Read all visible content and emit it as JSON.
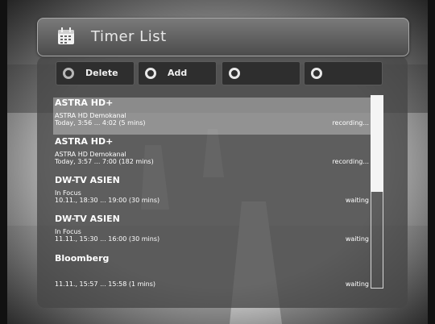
{
  "header": {
    "title": "Timer List",
    "icon": "calendar-icon"
  },
  "buttons": [
    {
      "label": "Delete",
      "color": "grey"
    },
    {
      "label": "Add",
      "color": "white"
    },
    {
      "label": "",
      "color": "white"
    },
    {
      "label": "",
      "color": "white"
    }
  ],
  "timers": [
    {
      "channel": "ASTRA HD+",
      "event": "ASTRA HD Demokanal",
      "time": "Today, 3:56 ... 4:02 (5 mins)",
      "status": "recording..."
    },
    {
      "channel": "ASTRA HD+",
      "event": "ASTRA HD Demokanal",
      "time": "Today, 3:57 ... 7:00 (182 mins)",
      "status": "recording..."
    },
    {
      "channel": "DW-TV ASIEN",
      "event": "In Focus",
      "time": "10.11., 18:30 ... 19:00 (30 mins)",
      "status": "waiting"
    },
    {
      "channel": "DW-TV ASIEN",
      "event": "In Focus",
      "time": "11.11., 15:30 ... 16:00 (30 mins)",
      "status": "waiting"
    },
    {
      "channel": "Bloomberg",
      "event": "",
      "time": "11.11., 15:57 ... 15:58 (1 mins)",
      "status": "waiting"
    }
  ],
  "scroll": {
    "position_fraction": 0.0,
    "visible_fraction": 0.5
  }
}
